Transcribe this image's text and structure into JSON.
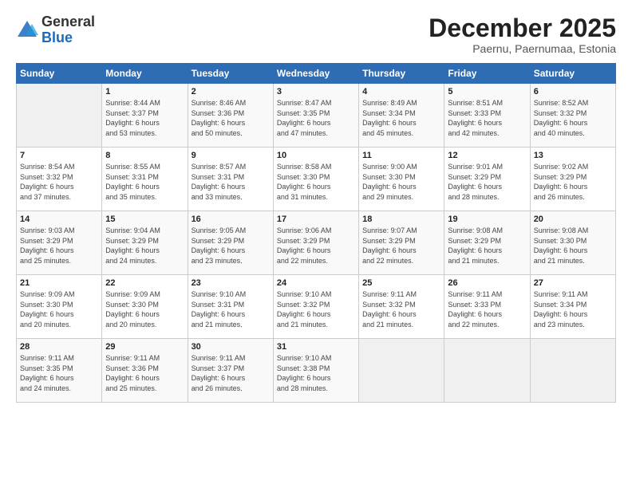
{
  "logo": {
    "general": "General",
    "blue": "Blue"
  },
  "title": "December 2025",
  "subtitle": "Paernu, Paernumaa, Estonia",
  "days_header": [
    "Sunday",
    "Monday",
    "Tuesday",
    "Wednesday",
    "Thursday",
    "Friday",
    "Saturday"
  ],
  "weeks": [
    [
      {
        "day": "",
        "info": ""
      },
      {
        "day": "1",
        "info": "Sunrise: 8:44 AM\nSunset: 3:37 PM\nDaylight: 6 hours\nand 53 minutes."
      },
      {
        "day": "2",
        "info": "Sunrise: 8:46 AM\nSunset: 3:36 PM\nDaylight: 6 hours\nand 50 minutes."
      },
      {
        "day": "3",
        "info": "Sunrise: 8:47 AM\nSunset: 3:35 PM\nDaylight: 6 hours\nand 47 minutes."
      },
      {
        "day": "4",
        "info": "Sunrise: 8:49 AM\nSunset: 3:34 PM\nDaylight: 6 hours\nand 45 minutes."
      },
      {
        "day": "5",
        "info": "Sunrise: 8:51 AM\nSunset: 3:33 PM\nDaylight: 6 hours\nand 42 minutes."
      },
      {
        "day": "6",
        "info": "Sunrise: 8:52 AM\nSunset: 3:32 PM\nDaylight: 6 hours\nand 40 minutes."
      }
    ],
    [
      {
        "day": "7",
        "info": "Sunrise: 8:54 AM\nSunset: 3:32 PM\nDaylight: 6 hours\nand 37 minutes."
      },
      {
        "day": "8",
        "info": "Sunrise: 8:55 AM\nSunset: 3:31 PM\nDaylight: 6 hours\nand 35 minutes."
      },
      {
        "day": "9",
        "info": "Sunrise: 8:57 AM\nSunset: 3:31 PM\nDaylight: 6 hours\nand 33 minutes."
      },
      {
        "day": "10",
        "info": "Sunrise: 8:58 AM\nSunset: 3:30 PM\nDaylight: 6 hours\nand 31 minutes."
      },
      {
        "day": "11",
        "info": "Sunrise: 9:00 AM\nSunset: 3:30 PM\nDaylight: 6 hours\nand 29 minutes."
      },
      {
        "day": "12",
        "info": "Sunrise: 9:01 AM\nSunset: 3:29 PM\nDaylight: 6 hours\nand 28 minutes."
      },
      {
        "day": "13",
        "info": "Sunrise: 9:02 AM\nSunset: 3:29 PM\nDaylight: 6 hours\nand 26 minutes."
      }
    ],
    [
      {
        "day": "14",
        "info": "Sunrise: 9:03 AM\nSunset: 3:29 PM\nDaylight: 6 hours\nand 25 minutes."
      },
      {
        "day": "15",
        "info": "Sunrise: 9:04 AM\nSunset: 3:29 PM\nDaylight: 6 hours\nand 24 minutes."
      },
      {
        "day": "16",
        "info": "Sunrise: 9:05 AM\nSunset: 3:29 PM\nDaylight: 6 hours\nand 23 minutes."
      },
      {
        "day": "17",
        "info": "Sunrise: 9:06 AM\nSunset: 3:29 PM\nDaylight: 6 hours\nand 22 minutes."
      },
      {
        "day": "18",
        "info": "Sunrise: 9:07 AM\nSunset: 3:29 PM\nDaylight: 6 hours\nand 22 minutes."
      },
      {
        "day": "19",
        "info": "Sunrise: 9:08 AM\nSunset: 3:29 PM\nDaylight: 6 hours\nand 21 minutes."
      },
      {
        "day": "20",
        "info": "Sunrise: 9:08 AM\nSunset: 3:30 PM\nDaylight: 6 hours\nand 21 minutes."
      }
    ],
    [
      {
        "day": "21",
        "info": "Sunrise: 9:09 AM\nSunset: 3:30 PM\nDaylight: 6 hours\nand 20 minutes."
      },
      {
        "day": "22",
        "info": "Sunrise: 9:09 AM\nSunset: 3:30 PM\nDaylight: 6 hours\nand 20 minutes."
      },
      {
        "day": "23",
        "info": "Sunrise: 9:10 AM\nSunset: 3:31 PM\nDaylight: 6 hours\nand 21 minutes."
      },
      {
        "day": "24",
        "info": "Sunrise: 9:10 AM\nSunset: 3:32 PM\nDaylight: 6 hours\nand 21 minutes."
      },
      {
        "day": "25",
        "info": "Sunrise: 9:11 AM\nSunset: 3:32 PM\nDaylight: 6 hours\nand 21 minutes."
      },
      {
        "day": "26",
        "info": "Sunrise: 9:11 AM\nSunset: 3:33 PM\nDaylight: 6 hours\nand 22 minutes."
      },
      {
        "day": "27",
        "info": "Sunrise: 9:11 AM\nSunset: 3:34 PM\nDaylight: 6 hours\nand 23 minutes."
      }
    ],
    [
      {
        "day": "28",
        "info": "Sunrise: 9:11 AM\nSunset: 3:35 PM\nDaylight: 6 hours\nand 24 minutes."
      },
      {
        "day": "29",
        "info": "Sunrise: 9:11 AM\nSunset: 3:36 PM\nDaylight: 6 hours\nand 25 minutes."
      },
      {
        "day": "30",
        "info": "Sunrise: 9:11 AM\nSunset: 3:37 PM\nDaylight: 6 hours\nand 26 minutes."
      },
      {
        "day": "31",
        "info": "Sunrise: 9:10 AM\nSunset: 3:38 PM\nDaylight: 6 hours\nand 28 minutes."
      },
      {
        "day": "",
        "info": ""
      },
      {
        "day": "",
        "info": ""
      },
      {
        "day": "",
        "info": ""
      }
    ]
  ]
}
